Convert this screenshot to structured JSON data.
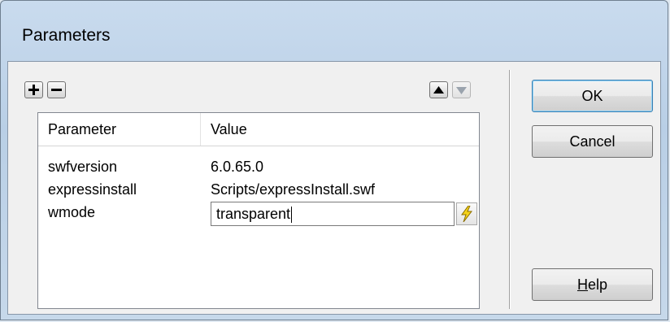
{
  "window": {
    "title": "Parameters"
  },
  "toolbar": {
    "add_icon": "plus-icon",
    "remove_icon": "minus-icon",
    "move_up_icon": "triangle-up-icon",
    "move_down_icon": "triangle-down-icon"
  },
  "table": {
    "columns": [
      "Parameter",
      "Value"
    ],
    "rows": [
      {
        "parameter": "swfversion",
        "value": "6.0.65.0"
      },
      {
        "parameter": "expressinstall",
        "value": "Scripts/expressInstall.swf"
      },
      {
        "parameter": "wmode",
        "value": "transparent"
      }
    ]
  },
  "buttons": {
    "ok": "OK",
    "cancel": "Cancel",
    "help_mnemonic": "H",
    "help_rest": "elp"
  },
  "colors": {
    "default_button_border": "#3c7fb1",
    "bolt_yellow": "#f5d31a"
  }
}
